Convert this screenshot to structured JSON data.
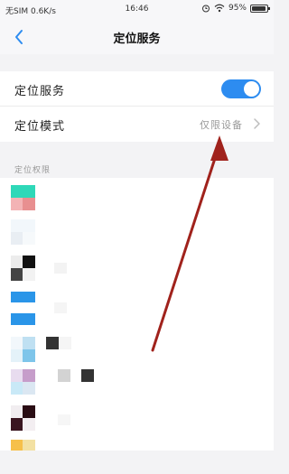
{
  "status": {
    "carrier": "无SIM 0.6K/s",
    "time": "16:46",
    "battery": "95%",
    "battery_level": 0.95
  },
  "header": {
    "title": "定位服务",
    "back_icon": "chevron-left-icon"
  },
  "settings": {
    "location_service_label": "定位服务",
    "location_service_on": true,
    "location_mode_label": "定位模式",
    "location_mode_value": "仅限设备",
    "mode_chevron_icon": "chevron-right-icon"
  },
  "permissions_section": {
    "title": "定位权限"
  },
  "colors": {
    "accent": "#2d8cf0",
    "annotation_arrow": "#a0221c"
  }
}
